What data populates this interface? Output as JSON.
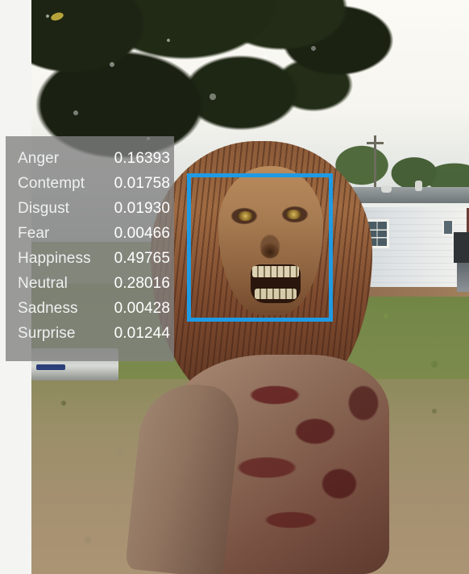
{
  "app": {
    "view_name": "face-emotion-analysis-result"
  },
  "photo": {
    "description": "Outdoor selfie photo of a zombie-costumed person standing on a lawn in front of a white house with a deck, under a dark tree canopy and bright sky"
  },
  "face_box": {
    "label": "detected-face-rectangle",
    "color": "#1f9ae3",
    "stroke_width_px": 5
  },
  "emotion_panel": {
    "background_color": "#808080",
    "text_color": "#ffffff",
    "rows": [
      {
        "label": "Anger",
        "value": "0.16393"
      },
      {
        "label": "Contempt",
        "value": "0.01758"
      },
      {
        "label": "Disgust",
        "value": "0.01930"
      },
      {
        "label": "Fear",
        "value": "0.00466"
      },
      {
        "label": "Happiness",
        "value": "0.49765"
      },
      {
        "label": "Neutral",
        "value": "0.28016"
      },
      {
        "label": "Sadness",
        "value": "0.00428"
      },
      {
        "label": "Surprise",
        "value": "0.01244"
      }
    ]
  }
}
